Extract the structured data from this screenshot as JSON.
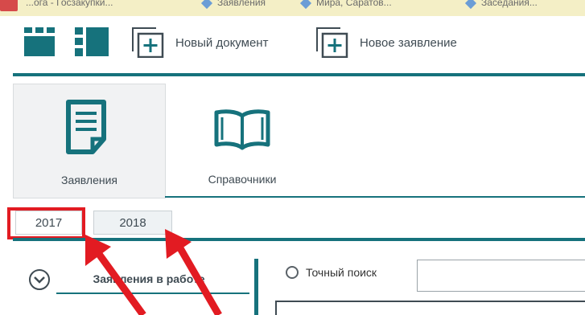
{
  "bookmarks": [
    {
      "label": "...ога - Госзакупки..."
    },
    {
      "label": "Заявления"
    },
    {
      "label": "Мира, Саратов..."
    },
    {
      "label": "Заседания..."
    }
  ],
  "toolbar": {
    "new_document_label": "Новый документ",
    "new_application_label": "Новое заявление"
  },
  "modules": [
    {
      "label": "Заявления",
      "icon": "document-icon",
      "active": true
    },
    {
      "label": "Справочники",
      "icon": "open-book-icon",
      "active": false
    }
  ],
  "year_tabs": [
    {
      "label": "2017",
      "selected": true
    },
    {
      "label": "2018",
      "selected": false
    }
  ],
  "sidebar": {
    "section_title": "Заявления в работе"
  },
  "search": {
    "exact_search_label": "Точный поиск",
    "value": "",
    "placeholder": ""
  },
  "colors": {
    "accent": "#16727c",
    "highlight": "#e21b22",
    "bookmark_bar": "#f4efc6"
  }
}
